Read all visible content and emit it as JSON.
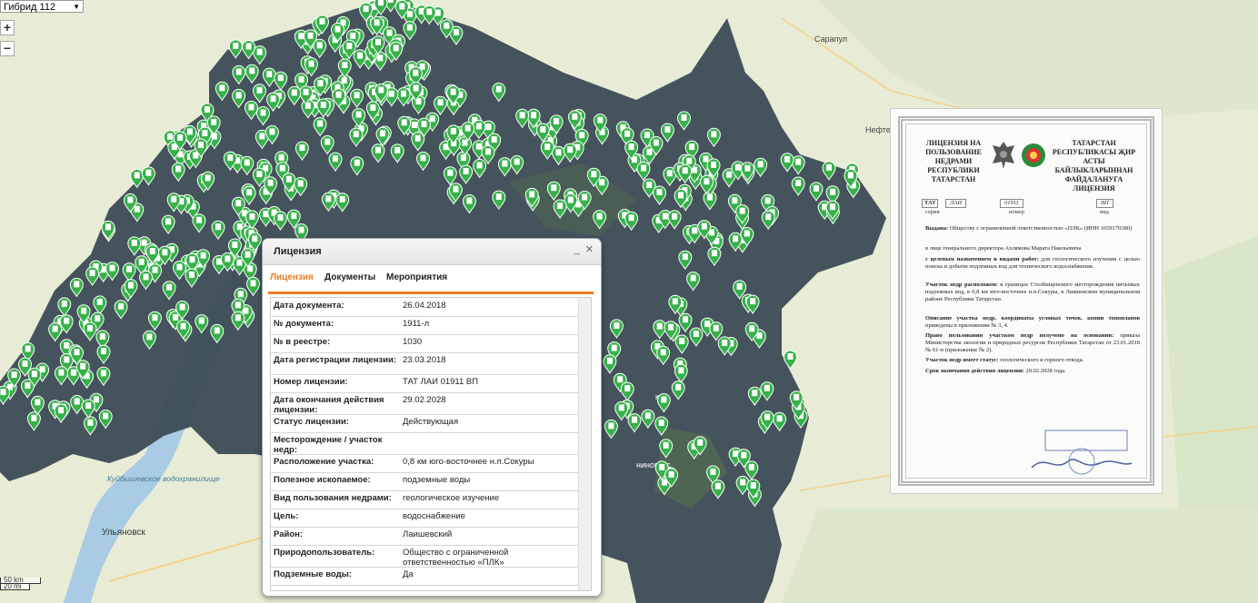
{
  "map": {
    "layer_select": "Гибрид 112",
    "zoom_in": "+",
    "zoom_out": "−",
    "scale_km": "50 km",
    "scale_mi": "20 mi",
    "place_labels": {
      "sarapul": "Сарапул",
      "neftekamsk": "Нефте",
      "ulyanovsk": "Ульяновск",
      "reservoir": "Куйбышевское водохранилище",
      "city_fragment": "к",
      "nizhnekamsk_fragment": "ниногорс"
    },
    "colors": {
      "marker": "#37b14a",
      "region": "#3a4a55",
      "water": "#a9cbe3"
    }
  },
  "popup": {
    "title": "Лицензия",
    "controls": {
      "minimize": "_",
      "close": "✕"
    },
    "tabs": [
      "Лицензия",
      "Документы",
      "Мероприятия"
    ],
    "active_tab": 0,
    "rows": [
      {
        "label": "Дата документа:",
        "value": "26.04.2018"
      },
      {
        "label": "№ документа:",
        "value": "1911-л"
      },
      {
        "label": "№ в реестре:",
        "value": "1030"
      },
      {
        "label": "Дата регистрации лицензии:",
        "value": "23.03.2018"
      },
      {
        "label": "Номер лицензии:",
        "value": "ТАТ ЛАИ 01911 ВП"
      },
      {
        "label": "Дата окончания действия лицензии:",
        "value": "29.02.2028"
      },
      {
        "label": "Статус лицензии:",
        "value": "Действующая"
      },
      {
        "label": "Месторождение / участок недр:",
        "value": ""
      },
      {
        "label": "Расположение участка:",
        "value": "0,8 км юго-восточнее н.п.Сокуры"
      },
      {
        "label": "Полезное ископаемое:",
        "value": "подземные воды"
      },
      {
        "label": "Вид пользования недрами:",
        "value": "геологическое изучение"
      },
      {
        "label": "Цель:",
        "value": "водоснабжение"
      },
      {
        "label": "Район:",
        "value": "Лаишевский"
      },
      {
        "label": "Природопользователь:",
        "value": "Общество с ограниченной ответственностью «ПЛК»"
      },
      {
        "label": "Подземные воды:",
        "value": "Да"
      }
    ]
  },
  "license_document": {
    "left_header": "ЛИЦЕНЗИЯ НА ПОЛЬЗОВАНИЕ НЕДРАМИ РЕСПУБЛИКИ ТАТАРСТАН",
    "right_header": "ТАТАРСТАН РЕСПУБЛИКАСЫ ҖИР АСТЫ БАЙЛЫКЛАРЫННАН ФАЙДАЛАНУГА ЛИЦЕНЗИЯ",
    "series": "ТАТ",
    "series_code": "ЛАИ",
    "number": "01911",
    "kind": "ВП",
    "series_label": "серия",
    "number_label": "номер",
    "kind_label": "вид",
    "issued_label": "Выдана:",
    "issued": "Обществу с ограниченной ответственностью «ПЛК» (ИНН 1659170380)",
    "represented": "в лице генерального директора Ахлямова Марата Наильевича",
    "purpose_label": "с целевым назначением и видами работ:",
    "purpose": "для геологического изучения с целью поиска и добычи подземных вод для технического водоснабжения.",
    "site_label": "Участок недр расположен:",
    "site": "в границах Столбищенского месторождения питьевых подземных вод, в 0,8 км юго-восточнее н.п.Сокуры, в Лаишевском муниципальном районе Республики Татарстан.",
    "coords_label": "Описание участка недр, координаты угловых точек, копии топопланов",
    "coords": "приведены в приложении № 3, 4.",
    "basis_label": "Право пользования участком недр получено на основании:",
    "basis": "приказа Министерства экологии и природных ресурсов Республики Татарстан от 23.01.2018 № 61-п (приложение № 2).",
    "status_label": "Участок недр имеет статус:",
    "status": "геологического и горного отвода.",
    "expiry_label": "Срок окончания действия лицензии:",
    "expiry": "29.02.2028 года."
  }
}
